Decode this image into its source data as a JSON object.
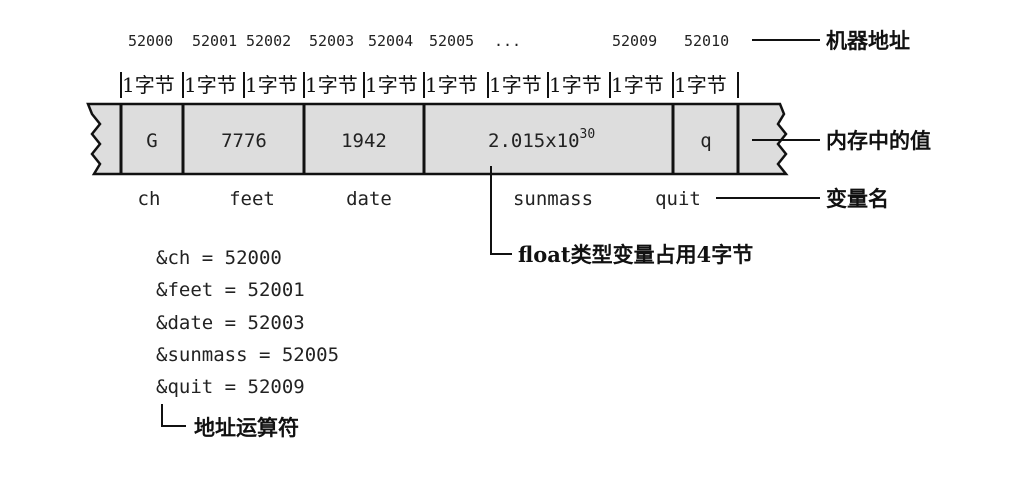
{
  "addresses": [
    "52000",
    "52001",
    "52002",
    "52003",
    "52004",
    "52005",
    "...",
    "52009",
    "52010"
  ],
  "byte_label": "1字节",
  "cells": {
    "ch": "G",
    "feet": "7776",
    "date": "1942",
    "sunmass_base": "2.015x10",
    "sunmass_exp": "30",
    "quit": "q"
  },
  "var_names": [
    "ch",
    "feet",
    "date",
    "sunmass",
    "quit"
  ],
  "labels": {
    "machine_address": "机器地址",
    "memory_value": "内存中的值",
    "var_name": "变量名",
    "float_note": "float类型变量占用4字节",
    "addr_operator": "地址运算符"
  },
  "code_lines": [
    "&ch = 52000",
    "&feet = 52001",
    "&date = 52003",
    "&sunmass = 52005",
    "&quit = 52009"
  ]
}
